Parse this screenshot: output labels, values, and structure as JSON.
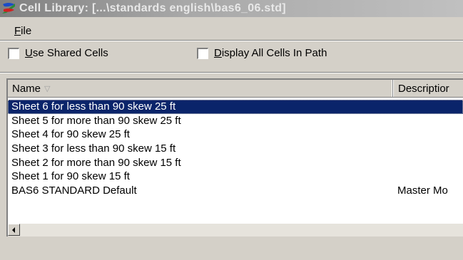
{
  "window": {
    "title": "Cell Library: [...\\standards english\\bas6_06.std]",
    "icon": "microstation-icon"
  },
  "menubar": {
    "file_label_underlined": "F",
    "file_label_rest": "ile"
  },
  "options": {
    "use_shared_cells": {
      "label_underlined": "U",
      "label_rest": "se Shared Cells",
      "checked": false
    },
    "display_all_cells": {
      "label_underlined": "D",
      "label_rest": "isplay All Cells In Path",
      "checked": false
    }
  },
  "list": {
    "columns": {
      "name": "Name",
      "description": "Descriptior",
      "sort_indicator": "▽"
    },
    "rows": [
      {
        "name": "Sheet 6 for less than 90 skew 25 ft",
        "description": "",
        "selected": true
      },
      {
        "name": "Sheet 5 for more than 90 skew 25 ft",
        "description": "",
        "selected": false
      },
      {
        "name": "Sheet 4 for 90 skew 25 ft",
        "description": "",
        "selected": false
      },
      {
        "name": "Sheet 3 for less than 90 skew 15 ft",
        "description": "",
        "selected": false
      },
      {
        "name": "Sheet 2 for more than 90 skew 15 ft",
        "description": "",
        "selected": false
      },
      {
        "name": "Sheet 1 for 90 skew 15 ft",
        "description": "",
        "selected": false
      },
      {
        "name": "BAS6 STANDARD Default",
        "description": "Master Mo",
        "selected": false
      }
    ]
  },
  "colors": {
    "selection": "#0a246a",
    "face": "#d4d0c8"
  }
}
